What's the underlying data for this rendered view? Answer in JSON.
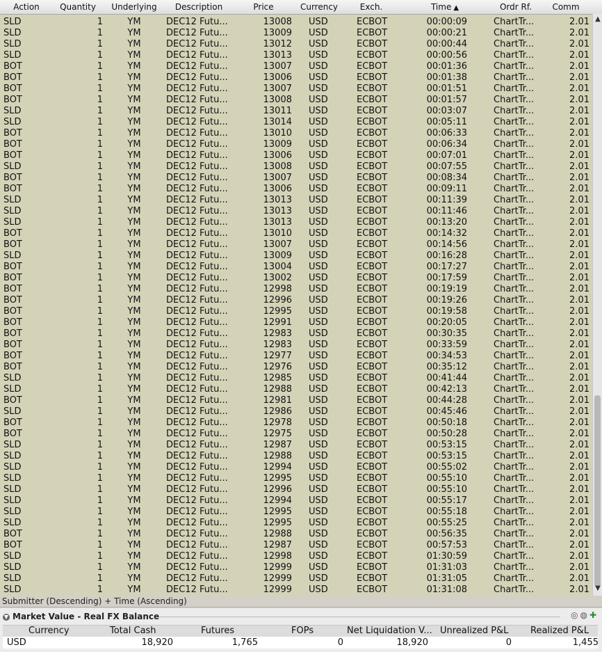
{
  "trades": {
    "columns": [
      {
        "label": "Action"
      },
      {
        "label": "Quantity"
      },
      {
        "label": "Underlying"
      },
      {
        "label": "Description"
      },
      {
        "label": "Price"
      },
      {
        "label": "Currency"
      },
      {
        "label": "Exch."
      },
      {
        "label": "Time",
        "sort_icon": "sort-ascending-icon"
      },
      {
        "label": "Ordr Rf."
      },
      {
        "label": "Comm"
      }
    ],
    "rows": [
      [
        "SLD",
        "1",
        "YM",
        "DEC12 Futu...",
        "13008",
        "USD",
        "ECBOT",
        "00:00:09",
        "ChartTr...",
        "2.01"
      ],
      [
        "SLD",
        "1",
        "YM",
        "DEC12 Futu...",
        "13009",
        "USD",
        "ECBOT",
        "00:00:21",
        "ChartTr...",
        "2.01"
      ],
      [
        "SLD",
        "1",
        "YM",
        "DEC12 Futu...",
        "13012",
        "USD",
        "ECBOT",
        "00:00:44",
        "ChartTr...",
        "2.01"
      ],
      [
        "SLD",
        "1",
        "YM",
        "DEC12 Futu...",
        "13013",
        "USD",
        "ECBOT",
        "00:00:56",
        "ChartTr...",
        "2.01"
      ],
      [
        "BOT",
        "1",
        "YM",
        "DEC12 Futu...",
        "13007",
        "USD",
        "ECBOT",
        "00:01:36",
        "ChartTr...",
        "2.01"
      ],
      [
        "BOT",
        "1",
        "YM",
        "DEC12 Futu...",
        "13006",
        "USD",
        "ECBOT",
        "00:01:38",
        "ChartTr...",
        "2.01"
      ],
      [
        "BOT",
        "1",
        "YM",
        "DEC12 Futu...",
        "13007",
        "USD",
        "ECBOT",
        "00:01:51",
        "ChartTr...",
        "2.01"
      ],
      [
        "BOT",
        "1",
        "YM",
        "DEC12 Futu...",
        "13008",
        "USD",
        "ECBOT",
        "00:01:57",
        "ChartTr...",
        "2.01"
      ],
      [
        "SLD",
        "1",
        "YM",
        "DEC12 Futu...",
        "13011",
        "USD",
        "ECBOT",
        "00:03:07",
        "ChartTr...",
        "2.01"
      ],
      [
        "SLD",
        "1",
        "YM",
        "DEC12 Futu...",
        "13014",
        "USD",
        "ECBOT",
        "00:05:11",
        "ChartTr...",
        "2.01"
      ],
      [
        "BOT",
        "1",
        "YM",
        "DEC12 Futu...",
        "13010",
        "USD",
        "ECBOT",
        "00:06:33",
        "ChartTr...",
        "2.01"
      ],
      [
        "BOT",
        "1",
        "YM",
        "DEC12 Futu...",
        "13009",
        "USD",
        "ECBOT",
        "00:06:34",
        "ChartTr...",
        "2.01"
      ],
      [
        "BOT",
        "1",
        "YM",
        "DEC12 Futu...",
        "13006",
        "USD",
        "ECBOT",
        "00:07:01",
        "ChartTr...",
        "2.01"
      ],
      [
        "SLD",
        "1",
        "YM",
        "DEC12 Futu...",
        "13008",
        "USD",
        "ECBOT",
        "00:07:55",
        "ChartTr...",
        "2.01"
      ],
      [
        "BOT",
        "1",
        "YM",
        "DEC12 Futu...",
        "13007",
        "USD",
        "ECBOT",
        "00:08:34",
        "ChartTr...",
        "2.01"
      ],
      [
        "BOT",
        "1",
        "YM",
        "DEC12 Futu...",
        "13006",
        "USD",
        "ECBOT",
        "00:09:11",
        "ChartTr...",
        "2.01"
      ],
      [
        "SLD",
        "1",
        "YM",
        "DEC12 Futu...",
        "13013",
        "USD",
        "ECBOT",
        "00:11:39",
        "ChartTr...",
        "2.01"
      ],
      [
        "SLD",
        "1",
        "YM",
        "DEC12 Futu...",
        "13013",
        "USD",
        "ECBOT",
        "00:11:46",
        "ChartTr...",
        "2.01"
      ],
      [
        "SLD",
        "1",
        "YM",
        "DEC12 Futu...",
        "13013",
        "USD",
        "ECBOT",
        "00:13:20",
        "ChartTr...",
        "2.01"
      ],
      [
        "BOT",
        "1",
        "YM",
        "DEC12 Futu...",
        "13010",
        "USD",
        "ECBOT",
        "00:14:32",
        "ChartTr...",
        "2.01"
      ],
      [
        "BOT",
        "1",
        "YM",
        "DEC12 Futu...",
        "13007",
        "USD",
        "ECBOT",
        "00:14:56",
        "ChartTr...",
        "2.01"
      ],
      [
        "SLD",
        "1",
        "YM",
        "DEC12 Futu...",
        "13009",
        "USD",
        "ECBOT",
        "00:16:28",
        "ChartTr...",
        "2.01"
      ],
      [
        "BOT",
        "1",
        "YM",
        "DEC12 Futu...",
        "13004",
        "USD",
        "ECBOT",
        "00:17:27",
        "ChartTr...",
        "2.01"
      ],
      [
        "BOT",
        "1",
        "YM",
        "DEC12 Futu...",
        "13002",
        "USD",
        "ECBOT",
        "00:17:59",
        "ChartTr...",
        "2.01"
      ],
      [
        "BOT",
        "1",
        "YM",
        "DEC12 Futu...",
        "12998",
        "USD",
        "ECBOT",
        "00:19:19",
        "ChartTr...",
        "2.01"
      ],
      [
        "BOT",
        "1",
        "YM",
        "DEC12 Futu...",
        "12996",
        "USD",
        "ECBOT",
        "00:19:26",
        "ChartTr...",
        "2.01"
      ],
      [
        "BOT",
        "1",
        "YM",
        "DEC12 Futu...",
        "12995",
        "USD",
        "ECBOT",
        "00:19:58",
        "ChartTr...",
        "2.01"
      ],
      [
        "BOT",
        "1",
        "YM",
        "DEC12 Futu...",
        "12991",
        "USD",
        "ECBOT",
        "00:20:05",
        "ChartTr...",
        "2.01"
      ],
      [
        "BOT",
        "1",
        "YM",
        "DEC12 Futu...",
        "12983",
        "USD",
        "ECBOT",
        "00:30:35",
        "ChartTr...",
        "2.01"
      ],
      [
        "BOT",
        "1",
        "YM",
        "DEC12 Futu...",
        "12983",
        "USD",
        "ECBOT",
        "00:33:59",
        "ChartTr...",
        "2.01"
      ],
      [
        "BOT",
        "1",
        "YM",
        "DEC12 Futu...",
        "12977",
        "USD",
        "ECBOT",
        "00:34:53",
        "ChartTr...",
        "2.01"
      ],
      [
        "BOT",
        "1",
        "YM",
        "DEC12 Futu...",
        "12976",
        "USD",
        "ECBOT",
        "00:35:12",
        "ChartTr...",
        "2.01"
      ],
      [
        "SLD",
        "1",
        "YM",
        "DEC12 Futu...",
        "12985",
        "USD",
        "ECBOT",
        "00:41:44",
        "ChartTr...",
        "2.01"
      ],
      [
        "SLD",
        "1",
        "YM",
        "DEC12 Futu...",
        "12988",
        "USD",
        "ECBOT",
        "00:42:13",
        "ChartTr...",
        "2.01"
      ],
      [
        "BOT",
        "1",
        "YM",
        "DEC12 Futu...",
        "12981",
        "USD",
        "ECBOT",
        "00:44:28",
        "ChartTr...",
        "2.01"
      ],
      [
        "SLD",
        "1",
        "YM",
        "DEC12 Futu...",
        "12986",
        "USD",
        "ECBOT",
        "00:45:46",
        "ChartTr...",
        "2.01"
      ],
      [
        "BOT",
        "1",
        "YM",
        "DEC12 Futu...",
        "12978",
        "USD",
        "ECBOT",
        "00:50:18",
        "ChartTr...",
        "2.01"
      ],
      [
        "BOT",
        "1",
        "YM",
        "DEC12 Futu...",
        "12975",
        "USD",
        "ECBOT",
        "00:50:28",
        "ChartTr...",
        "2.01"
      ],
      [
        "SLD",
        "1",
        "YM",
        "DEC12 Futu...",
        "12987",
        "USD",
        "ECBOT",
        "00:53:15",
        "ChartTr...",
        "2.01"
      ],
      [
        "SLD",
        "1",
        "YM",
        "DEC12 Futu...",
        "12988",
        "USD",
        "ECBOT",
        "00:53:15",
        "ChartTr...",
        "2.01"
      ],
      [
        "SLD",
        "1",
        "YM",
        "DEC12 Futu...",
        "12994",
        "USD",
        "ECBOT",
        "00:55:02",
        "ChartTr...",
        "2.01"
      ],
      [
        "SLD",
        "1",
        "YM",
        "DEC12 Futu...",
        "12995",
        "USD",
        "ECBOT",
        "00:55:10",
        "ChartTr...",
        "2.01"
      ],
      [
        "SLD",
        "1",
        "YM",
        "DEC12 Futu...",
        "12996",
        "USD",
        "ECBOT",
        "00:55:10",
        "ChartTr...",
        "2.01"
      ],
      [
        "SLD",
        "1",
        "YM",
        "DEC12 Futu...",
        "12994",
        "USD",
        "ECBOT",
        "00:55:17",
        "ChartTr...",
        "2.01"
      ],
      [
        "SLD",
        "1",
        "YM",
        "DEC12 Futu...",
        "12995",
        "USD",
        "ECBOT",
        "00:55:18",
        "ChartTr...",
        "2.01"
      ],
      [
        "SLD",
        "1",
        "YM",
        "DEC12 Futu...",
        "12995",
        "USD",
        "ECBOT",
        "00:55:25",
        "ChartTr...",
        "2.01"
      ],
      [
        "BOT",
        "1",
        "YM",
        "DEC12 Futu...",
        "12988",
        "USD",
        "ECBOT",
        "00:56:35",
        "ChartTr...",
        "2.01"
      ],
      [
        "BOT",
        "1",
        "YM",
        "DEC12 Futu...",
        "12987",
        "USD",
        "ECBOT",
        "00:57:53",
        "ChartTr...",
        "2.01"
      ],
      [
        "SLD",
        "1",
        "YM",
        "DEC12 Futu...",
        "12998",
        "USD",
        "ECBOT",
        "01:30:59",
        "ChartTr...",
        "2.01"
      ],
      [
        "SLD",
        "1",
        "YM",
        "DEC12 Futu...",
        "12999",
        "USD",
        "ECBOT",
        "01:31:03",
        "ChartTr...",
        "2.01"
      ],
      [
        "SLD",
        "1",
        "YM",
        "DEC12 Futu...",
        "12999",
        "USD",
        "ECBOT",
        "01:31:05",
        "ChartTr...",
        "2.01"
      ],
      [
        "SLD",
        "1",
        "YM",
        "DEC12 Futu...",
        "12999",
        "USD",
        "ECBOT",
        "01:31:08",
        "ChartTr...",
        "2.01"
      ]
    ]
  },
  "sort_status": "Submitter (Descending)  +  Time (Ascending)",
  "market_value": {
    "title": "Market Value - Real FX Balance",
    "collapse_icon": "collapse-circle-icon",
    "columns": [
      "Currency",
      "Total Cash",
      "Futures",
      "FOPs",
      "Net Liquidation V...",
      "Unrealized P&L",
      "Realized P&L"
    ],
    "row": [
      "USD",
      "18,920",
      "1,765",
      "0",
      "18,920",
      "0",
      "1,455"
    ]
  },
  "colors": {
    "grid_bg": "#d4d3b8",
    "header_bg": "#e8e8e8",
    "panel_bg": "#ececec"
  }
}
